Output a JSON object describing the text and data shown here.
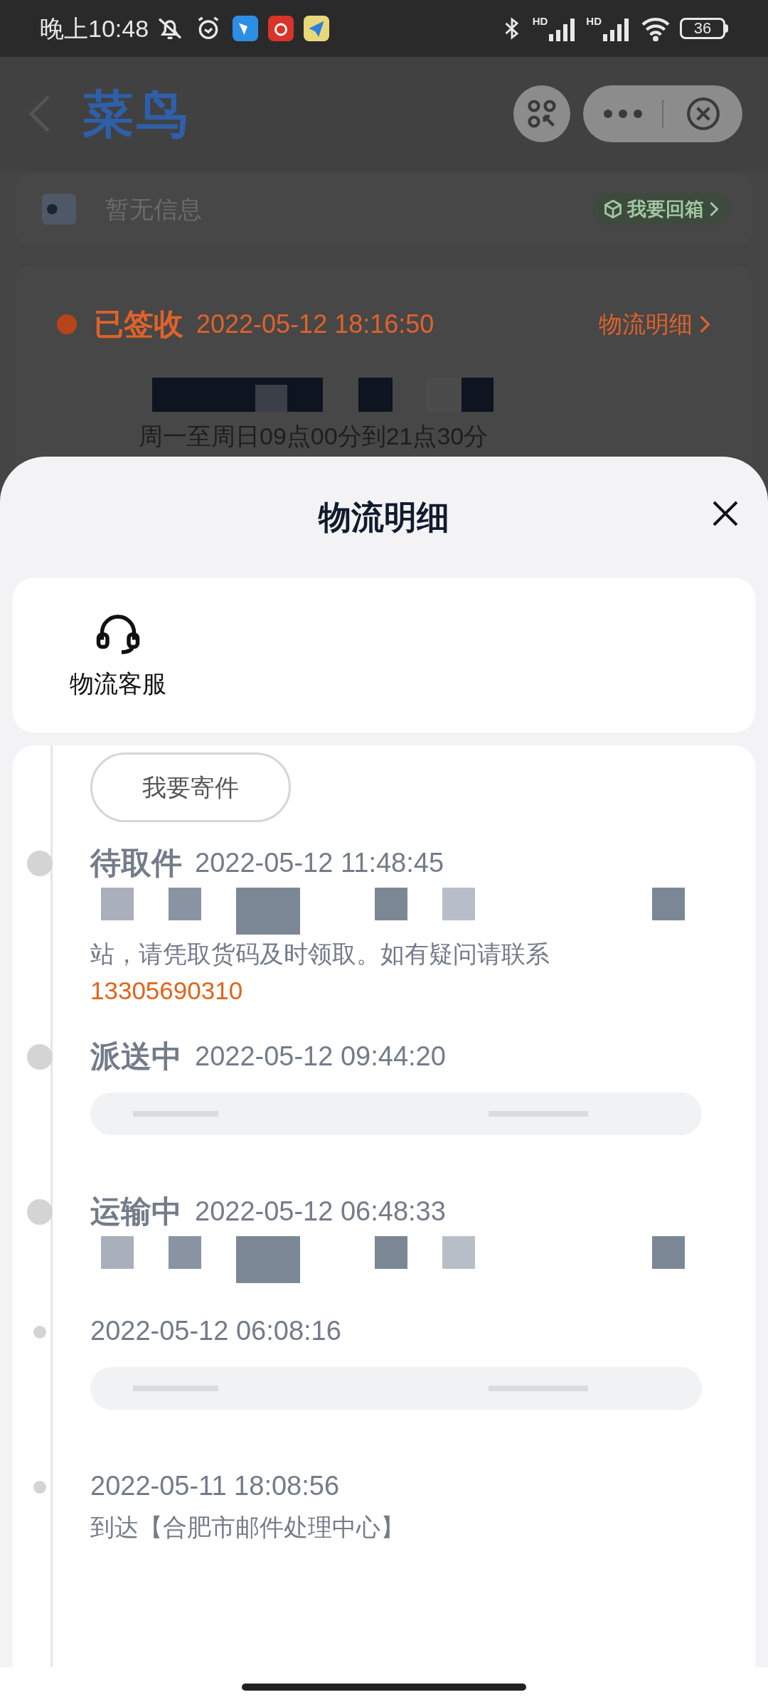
{
  "status_bar": {
    "time": "晚上10:48",
    "signals": [
      {
        "label": "HD"
      },
      {
        "label": "HD"
      }
    ],
    "battery": "36"
  },
  "nav": {
    "logo": "菜鸟"
  },
  "notice": {
    "text": "暂无信息",
    "action": "我要回箱"
  },
  "package": {
    "status": "已签收",
    "time": "2022-05-12 18:16:50",
    "link": "物流明细",
    "hours": "周一至周日09点00分到21点30分"
  },
  "sheet": {
    "title": "物流明细",
    "services": [
      {
        "label": "物流客服"
      }
    ],
    "send_button": "我要寄件",
    "events": [
      {
        "status": "待取件",
        "time": "2022-05-12 11:48:45",
        "lines": [
          {
            "kind": "redacted"
          },
          {
            "kind": "text",
            "text": "站，请凭取货码及时领取。如有疑问请联系"
          },
          {
            "kind": "phone",
            "text": "13305690310"
          }
        ]
      },
      {
        "status": "派送中",
        "time": "2022-05-12 09:44:20",
        "lines": [
          {
            "kind": "blurred"
          }
        ]
      },
      {
        "status": "运输中",
        "time": "2022-05-12 06:48:33",
        "lines": [
          {
            "kind": "redacted"
          }
        ]
      },
      {
        "time": "2022-05-12 06:08:16",
        "lines": [
          {
            "kind": "blurred"
          }
        ]
      },
      {
        "time": "2022-05-11 18:08:56",
        "lines": [
          {
            "kind": "text",
            "text": "到达【合肥市邮件处理中心】"
          }
        ]
      }
    ]
  }
}
